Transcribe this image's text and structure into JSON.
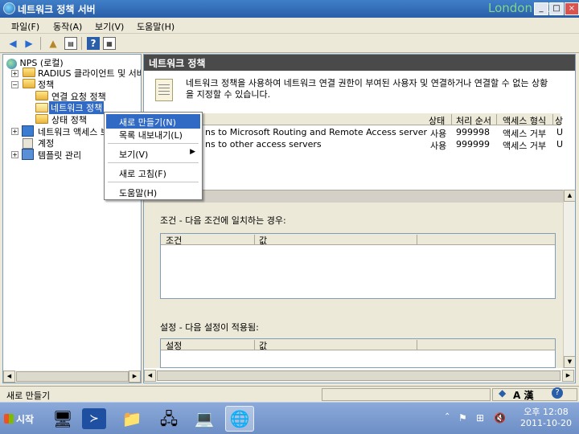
{
  "window": {
    "title": "네트워크 정책 서버",
    "watermark": "London SQL"
  },
  "menu": [
    "파일(F)",
    "동작(A)",
    "보기(V)",
    "도움말(H)"
  ],
  "tree": {
    "root": "NPS (로컬)",
    "radius": "RADIUS 클라이언트 및 서버",
    "policies": "정책",
    "conn_req": "연결 요청 정책",
    "net_policies": "네트워크 정책",
    "health": "상태 정책",
    "nap": "네트워크 액세스 보호",
    "accounting": "계정",
    "templates": "템플릿 관리"
  },
  "pane": {
    "header": "네트워크 정책",
    "description": "네트워크 정책을 사용하여 네트워크 연결 권한이 부여된 사용자 및 연결하거나 연결할 수 없는 상황을 지정할 수 있습니다.",
    "columns": {
      "status": "상태",
      "order": "처리 순서",
      "access": "액세스 형식",
      "more": "상"
    },
    "rows": [
      {
        "name": "ns to Microsoft Routing and Remote Access server",
        "status": "사용",
        "order": "999998",
        "access": "액세스 거부",
        "extra": "U"
      },
      {
        "name": "ns to other access servers",
        "status": "사용",
        "order": "999999",
        "access": "액세스 거부",
        "extra": "U"
      }
    ]
  },
  "conditions": {
    "title": "조건 - 다음 조건에 일치하는 경우:",
    "col_condition": "조건",
    "col_value": "값"
  },
  "settings": {
    "title": "설정 - 다음 설정이 적용됨:",
    "col_setting": "설정",
    "col_value": "값"
  },
  "context_menu": {
    "new": "새로 만들기(N)",
    "export": "목록 내보내기(L)",
    "view": "보기(V)",
    "refresh": "새로 고침(F)",
    "help": "도움말(H)"
  },
  "status": {
    "text": "새로 만들기"
  },
  "taskbar": {
    "start": "시작",
    "tray_lang": "A 漢",
    "time": "오후 12:08",
    "date": "2011-10-20"
  }
}
